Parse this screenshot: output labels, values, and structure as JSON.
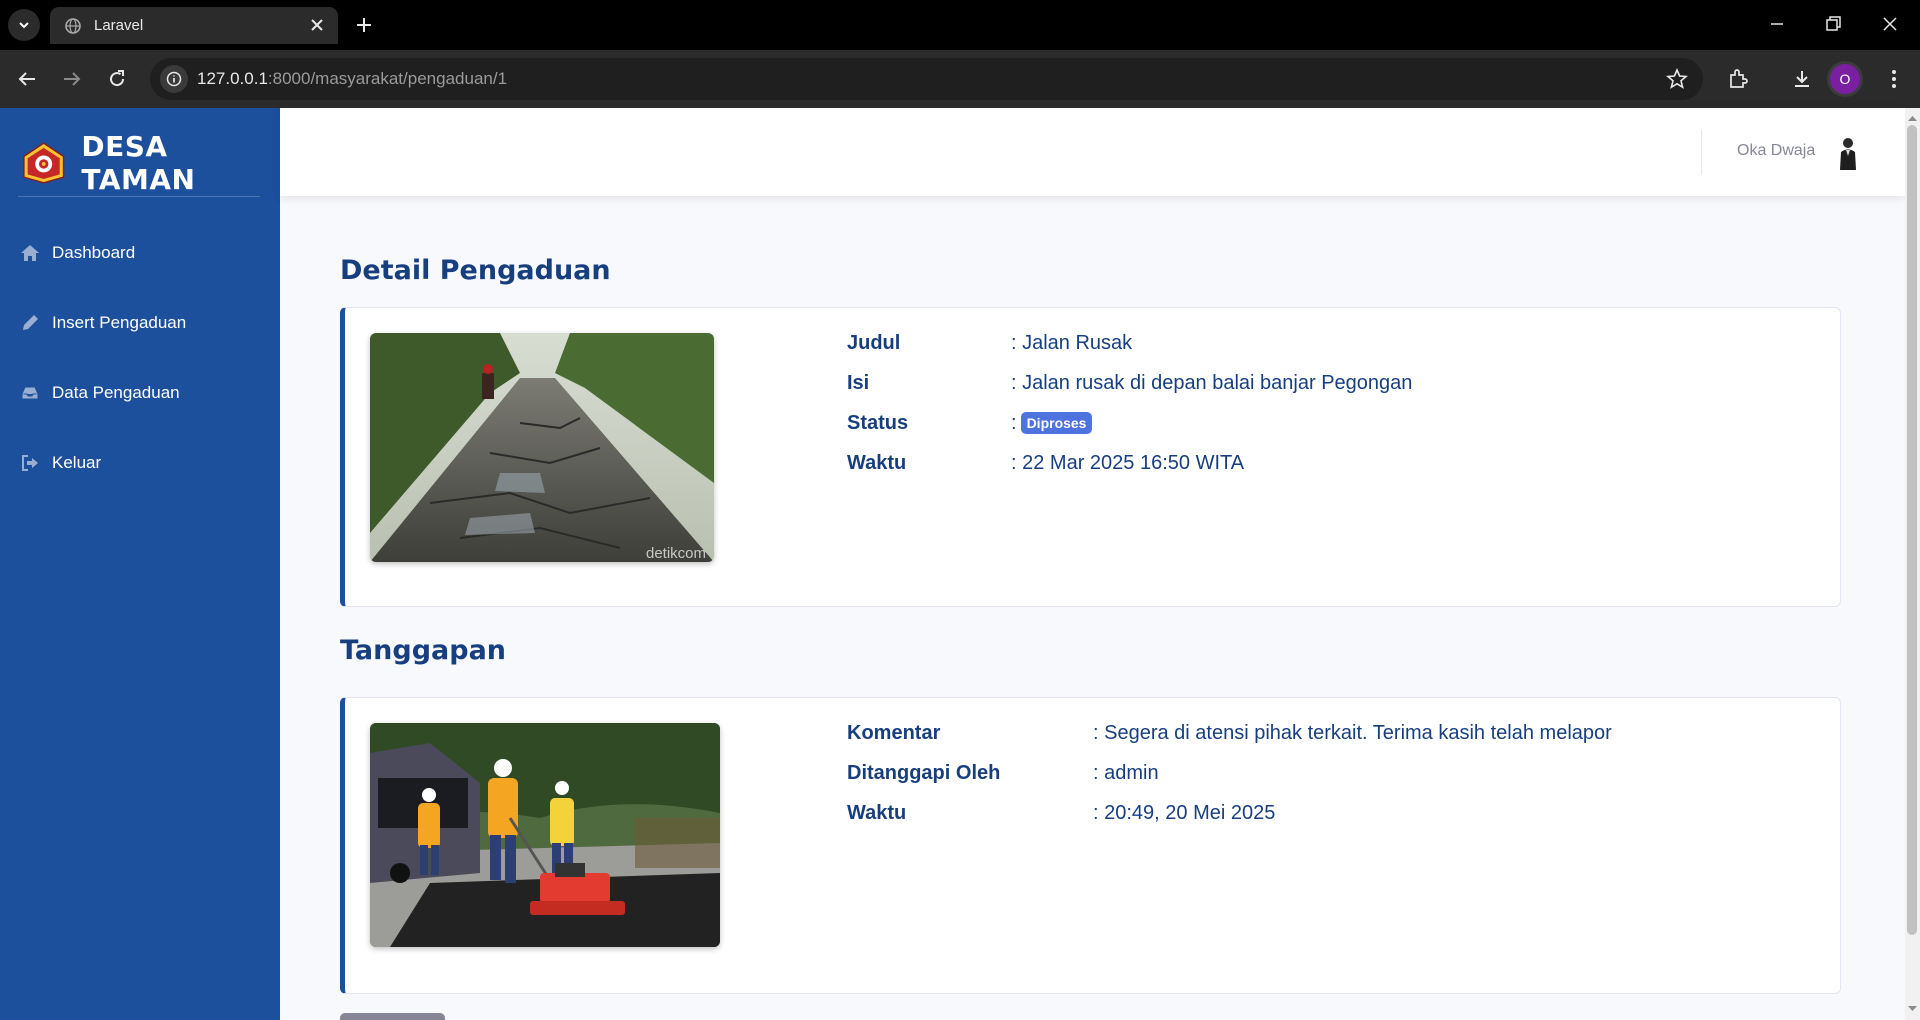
{
  "browser": {
    "tab_title": "Laravel",
    "url_host": "127.0.0.1",
    "url_path": ":8000/masyarakat/pengaduan/1",
    "profile_initial": "O"
  },
  "sidebar": {
    "brand": "DESA TAMAN",
    "items": [
      {
        "label": "Dashboard",
        "icon": "home-icon"
      },
      {
        "label": "Insert Pengaduan",
        "icon": "pencil-icon"
      },
      {
        "label": "Data Pengaduan",
        "icon": "inbox-icon"
      },
      {
        "label": "Keluar",
        "icon": "sign-out-icon"
      }
    ]
  },
  "topbar": {
    "user_name": "Oka Dwaja"
  },
  "detail": {
    "title": "Detail Pengaduan",
    "fields": [
      {
        "label": "Judul",
        "value": ": Jalan Rusak"
      },
      {
        "label": "Isi",
        "value": ": Jalan rusak di depan balai banjar Pegongan"
      },
      {
        "label": "Status",
        "prefix": ":",
        "badge": "Diproses"
      },
      {
        "label": "Waktu",
        "value": ": 22 Mar 2025 16:50 WITA"
      }
    ],
    "photo_watermark": "detikcom"
  },
  "response": {
    "title": "Tanggapan",
    "fields": [
      {
        "label": "Komentar",
        "value": ": Segera di atensi pihak terkait. Terima kasih telah melapor"
      },
      {
        "label": "Ditanggapi Oleh",
        "value": ": admin"
      },
      {
        "label": "Waktu",
        "value": ": 20:49, 20 Mei 2025"
      }
    ]
  },
  "colors": {
    "sidebar": "#1c4f9c",
    "heading": "#173f80",
    "badge": "#4e73df"
  }
}
